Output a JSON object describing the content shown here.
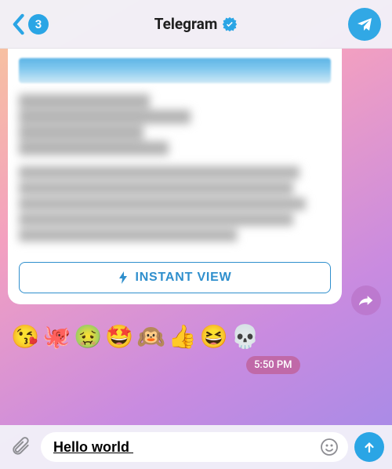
{
  "header": {
    "unread_count": "3",
    "title": "Telegram"
  },
  "message": {
    "instant_view_label": "INSTANT VIEW",
    "timestamp": "5:50 PM",
    "reactions": [
      "😘",
      "🐙",
      "🤢",
      "🤩",
      "🙉",
      "👍",
      "😆",
      "💀"
    ]
  },
  "composer": {
    "input_value": "Hello world "
  }
}
